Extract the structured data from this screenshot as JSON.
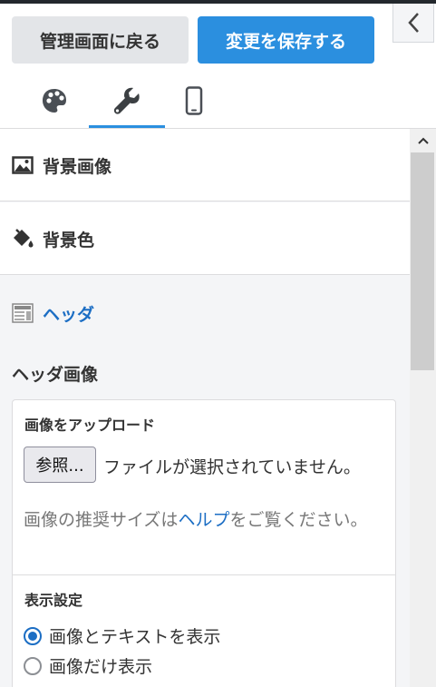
{
  "toolbar": {
    "back_label": "管理画面に戻る",
    "save_label": "変更を保存する"
  },
  "tabs": [
    {
      "icon": "palette-icon",
      "active": false
    },
    {
      "icon": "wrench-icon",
      "active": true
    },
    {
      "icon": "mobile-icon",
      "active": false
    }
  ],
  "sections": [
    {
      "icon": "image-icon",
      "label": "背景画像"
    },
    {
      "icon": "paint-bucket-icon",
      "label": "背景色"
    },
    {
      "icon": "header-layout-icon",
      "label": "ヘッダ"
    }
  ],
  "header_image": {
    "title": "ヘッダ画像",
    "upload_label": "画像をアップロード",
    "browse_label": "参照...",
    "no_file_text": "ファイルが選択されていません。",
    "help_prefix": "画像の推奨サイズは",
    "help_link": "ヘルプ",
    "help_suffix": "をご覧ください。",
    "display_label": "表示設定",
    "options": [
      "画像とテキストを表示",
      "画像だけ表示"
    ],
    "selected_option": "画像とテキストを表示"
  },
  "colors": {
    "accent": "#2b8fdf",
    "link": "#1c6ec4",
    "panel_bg": "#f4f5f7"
  }
}
